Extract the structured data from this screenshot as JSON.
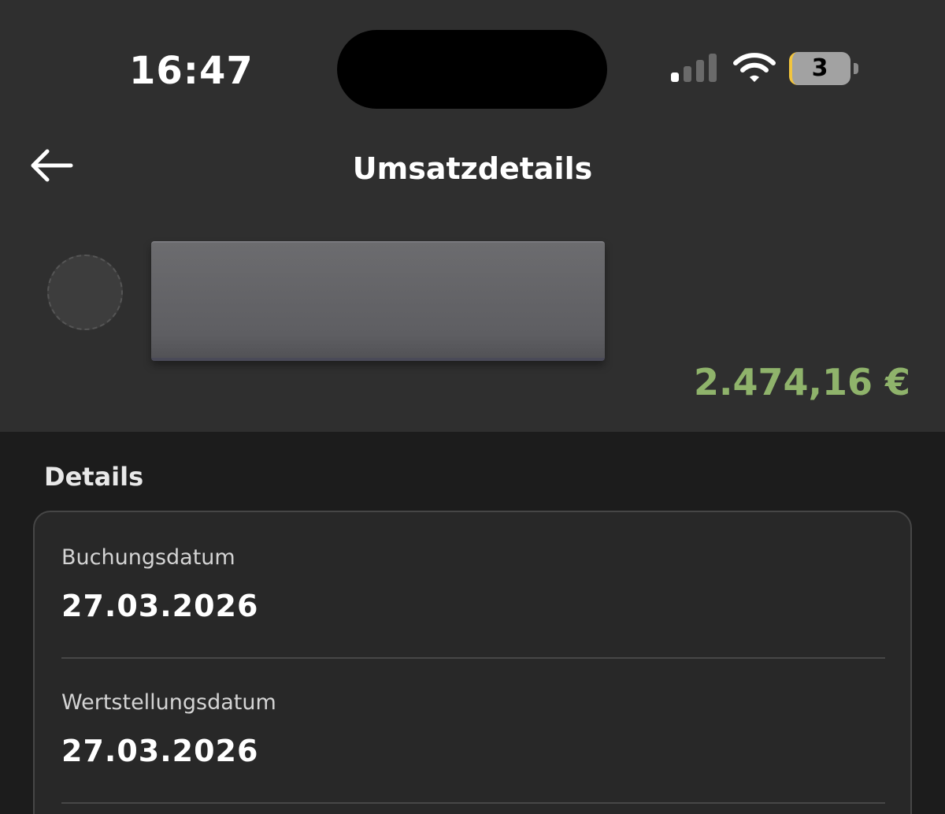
{
  "status_bar": {
    "time": "16:47",
    "battery_level": "3",
    "icons": [
      "signal-icon",
      "wifi-icon",
      "battery-icon"
    ]
  },
  "nav": {
    "back_icon": "arrow-left-icon",
    "title": "Umsatzdetails"
  },
  "transaction": {
    "amount": "2.474,16 €",
    "amount_color": "#8fb36b"
  },
  "details": {
    "section_title": "Details",
    "rows": [
      {
        "label": "Buchungsdatum",
        "value": "27.03.2026"
      },
      {
        "label": "Wertstellungsdatum",
        "value": "27.03.2026"
      }
    ]
  }
}
